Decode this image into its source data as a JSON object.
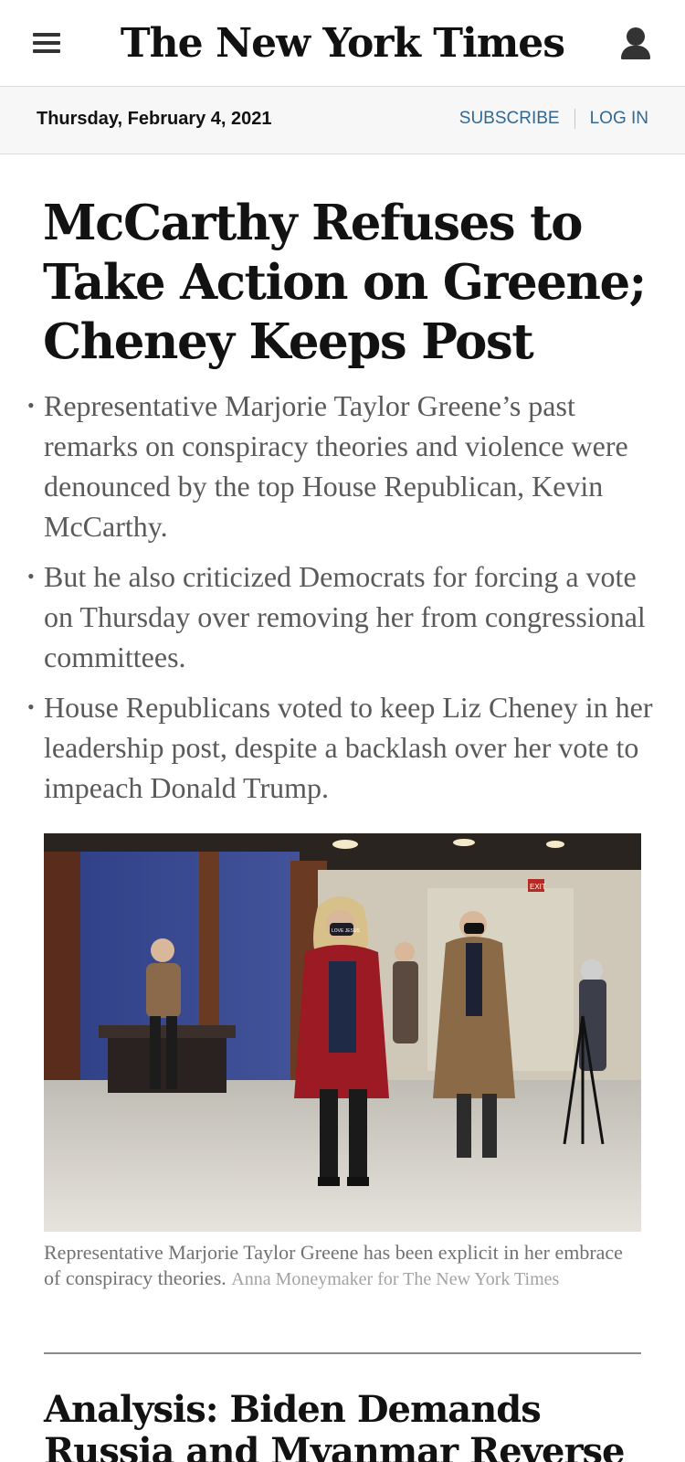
{
  "header": {
    "logo_text": "The New York Times",
    "menu_icon": "hamburger-menu-icon",
    "account_icon": "user-account-icon"
  },
  "datebar": {
    "date": "Thursday, February 4, 2021",
    "subscribe_label": "SUBSCRIBE",
    "login_label": "LOG IN",
    "link_color": "#326891"
  },
  "article": {
    "headline": "McCarthy Refuses to Take Action on Greene; Cheney Keeps Post",
    "summary": [
      "Representative Marjorie Taylor Greene’s past remarks on conspiracy theories and violence were denounced by the top House Republican, Kevin McCarthy.",
      "But he also criticized Democrats for forcing a vote on Thursday over removing her from congressional committees.",
      "House Republicans voted to keep Liz Cheney in her leadership post, despite a backlash over her vote to impeach Donald Trump."
    ],
    "bullet_glyph": "•",
    "photo": {
      "mask_text": "LOVE JESUS",
      "exit_sign": "EXIT"
    },
    "caption": "Representative Marjorie Taylor Greene has been explicit in her embrace of conspiracy theories.",
    "credit": "Anna Moneymaker for The New York Times"
  },
  "next_story": {
    "headline": "Analysis: Biden Demands Russia and Myanmar Reverse Course"
  }
}
